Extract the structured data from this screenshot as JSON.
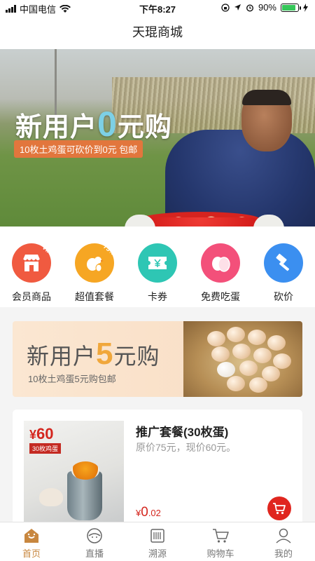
{
  "status_bar": {
    "carrier": "中国电信",
    "time": "下午8:27",
    "battery_percent": "90%"
  },
  "header": {
    "title": "天琨商城"
  },
  "banner": {
    "title_before": "新用户",
    "title_number": "0",
    "title_after": "元购",
    "subtitle": "10枚土鸡蛋可砍价到0元 包邮"
  },
  "menu": {
    "items": [
      {
        "label": "会员商品",
        "badge": "VIP",
        "icon": "shop-icon",
        "color": "#f05a40"
      },
      {
        "label": "超值套餐",
        "badge": "75%",
        "icon": "chicken-egg-icon",
        "color": "#f6a623"
      },
      {
        "label": "卡券",
        "badge": "",
        "icon": "coupon-icon",
        "color": "#2ec6b4"
      },
      {
        "label": "免费吃蛋",
        "badge": "",
        "icon": "free-egg-icon",
        "color": "#f3507a"
      },
      {
        "label": "砍价",
        "badge": "",
        "icon": "hammer-icon",
        "color": "#3b8ff0"
      }
    ]
  },
  "promo": {
    "title_before": "新用户",
    "title_number": "5",
    "title_after": "元购",
    "subtitle": "10枚土鸡蛋5元购包邮"
  },
  "product": {
    "image_price_symbol": "¥",
    "image_price": "60",
    "image_tag": "30枚鸡蛋",
    "name": "推广套餐(30枚蛋)",
    "description": "原价75元，现价60元。",
    "price_symbol": "¥",
    "price_int": "0",
    "price_dec": ".02"
  },
  "tabbar": {
    "items": [
      {
        "label": "首页",
        "icon": "home-icon",
        "active": true
      },
      {
        "label": "直播",
        "icon": "live-icon",
        "active": false
      },
      {
        "label": "溯源",
        "icon": "trace-icon",
        "active": false
      },
      {
        "label": "购物车",
        "icon": "cart-icon",
        "active": false
      },
      {
        "label": "我的",
        "icon": "profile-icon",
        "active": false
      }
    ]
  },
  "colors": {
    "accent_red": "#e0261f",
    "tab_active": "#c8873f",
    "promo_number": "#f0a73b"
  }
}
